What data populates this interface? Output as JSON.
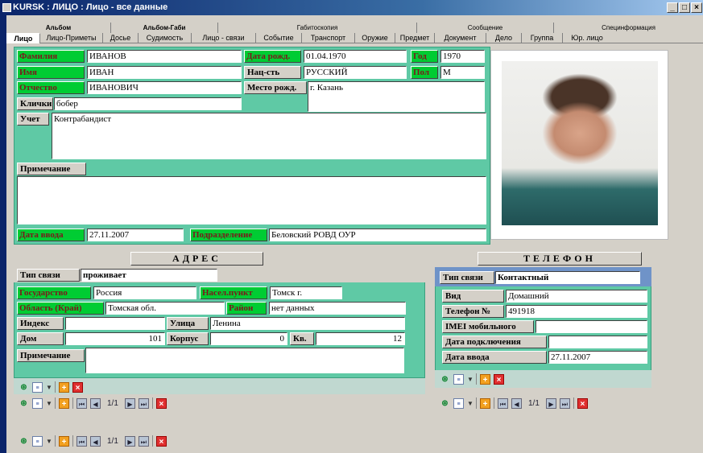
{
  "window": {
    "title": "KURSK : ЛИЦО : Лицо - все данные",
    "buttons": [
      "_",
      "□",
      "×"
    ]
  },
  "tabs_top": [
    "Альбом",
    "Альбом-Габи",
    "Габитоскопия",
    "Сообщение",
    "Специнформация"
  ],
  "tabs_bottom": [
    "Лицо",
    "Лицо-Приметы",
    "Досье",
    "Судимость",
    "Лицо - связи",
    "Событие",
    "Транспорт",
    "Оружие",
    "Предмет",
    "Документ",
    "Дело",
    "Группа",
    "Юр. лицо"
  ],
  "person": {
    "surname_label": "Фамилия",
    "surname": "ИВАНОВ",
    "name_label": "Имя",
    "name": "ИВАН",
    "patronymic_label": "Отчество",
    "patronymic": "ИВАНОВИЧ",
    "dob_label": "Дата рожд.",
    "dob": "01.04.1970",
    "year_label": "Год",
    "year": "1970",
    "nationality_label": "Нац-сть",
    "nationality": "РУССКИЙ",
    "sex_label": "Пол",
    "sex": "М",
    "birthplace_label": "Место рожд.",
    "birthplace": "г. Казань",
    "nicknames_label": "Клички",
    "nicknames": "бобер",
    "record_label": "Учет",
    "record": "Контрабандист",
    "note_label": "Примечание",
    "note": "",
    "entry_date_label": "Дата ввода",
    "entry_date": "27.11.2007",
    "department_label": "Подразделение",
    "department": "Беловский РОВД ОУР"
  },
  "address": {
    "header": "АДРЕС",
    "link_type_label": "Тип связи",
    "link_type": "проживает",
    "country_label": "Государство",
    "country": "Россия",
    "locality_label": "Насел.пункт",
    "locality": "Томск г.",
    "region_label": "Область (Край)",
    "region": "Томская обл.",
    "district_label": "Район",
    "district": "нет данных",
    "index_label": "Индекс",
    "index": "",
    "street_label": "Улица",
    "street": "Ленина",
    "house_label": "Дом",
    "house": "101",
    "building_label": "Корпус",
    "building": "0",
    "flat_label": "Кв.",
    "flat": "12",
    "note_label": "Примечание",
    "note": ""
  },
  "phone": {
    "header": "ТЕЛЕФОН",
    "link_type_label": "Тип связи",
    "link_type": "Контактный",
    "kind_label": "Вид",
    "kind": "Домашний",
    "number_label": "Телефон №",
    "number": "491918",
    "imei_label": "IMEI мобильного",
    "imei": "",
    "connect_date_label": "Дата подключения",
    "connect_date": "",
    "entry_date_label": "Дата ввода",
    "entry_date": "27.11.2007"
  },
  "nav": {
    "record_counter": "1/1"
  },
  "colors": {
    "green_label": "#00cc33",
    "panel": "#5fc9a5",
    "window_bg": "#d4d0c8",
    "titlebar": "#0a246a"
  }
}
